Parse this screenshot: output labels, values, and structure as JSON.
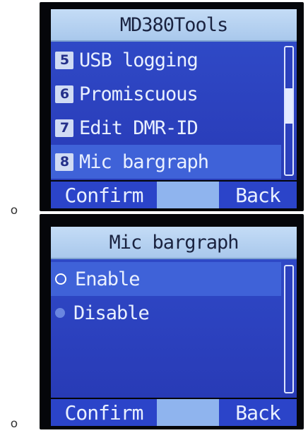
{
  "screens": [
    {
      "title": "MD380Tools",
      "menu": [
        {
          "number": "5",
          "label": "USB logging"
        },
        {
          "number": "6",
          "label": "Promiscuous"
        },
        {
          "number": "7",
          "label": "Edit DMR-ID"
        },
        {
          "number": "8",
          "label": "Mic bargraph",
          "selected": true
        }
      ],
      "softkeys": {
        "left": "Confirm",
        "right": "Back"
      }
    },
    {
      "title": "Mic bargraph",
      "options": [
        {
          "label": "Enable",
          "selected": true
        },
        {
          "label": "Disable",
          "selected": false
        }
      ],
      "softkeys": {
        "left": "Confirm",
        "right": "Back"
      }
    }
  ],
  "bullets": [
    "o",
    "o"
  ],
  "colors": {
    "title_bar": "#b7d2f2",
    "list_background": "#2b40bd",
    "selected_row": "#3f62d8",
    "softkey": "#2b44c9"
  }
}
